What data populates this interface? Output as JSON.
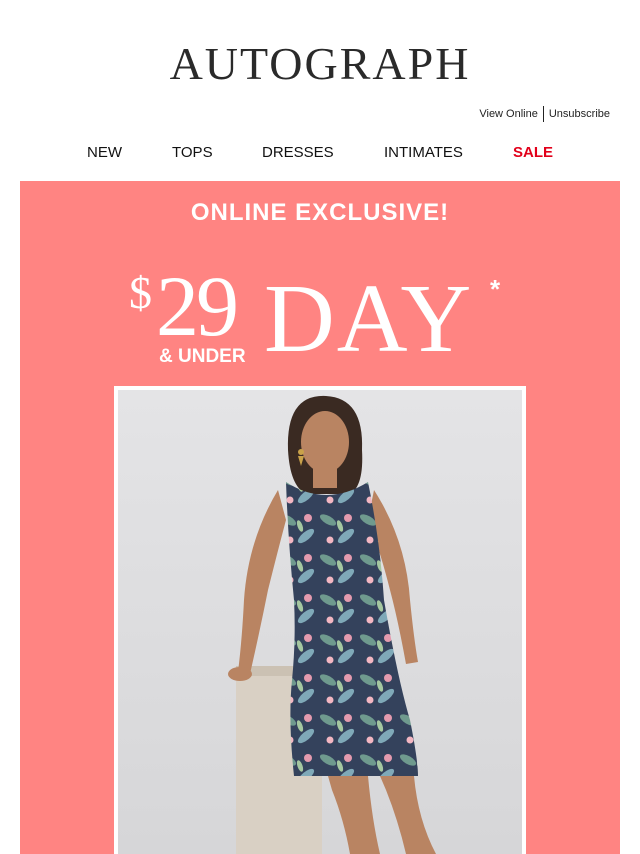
{
  "header": {
    "brand": "AUTOGRAPH",
    "view_online": "View Online",
    "unsubscribe": "Unsubscribe"
  },
  "nav": {
    "items": [
      "NEW",
      "TOPS",
      "DRESSES",
      "INTIMATES",
      "SALE"
    ]
  },
  "hero": {
    "kicker": "ONLINE EXCLUSIVE!",
    "currency": "$",
    "price": "29",
    "price_suffix": "& UNDER",
    "day": "DAY",
    "asterisk": "*"
  },
  "colors": {
    "hero_bg": "#ff8482",
    "sale": "#e2001a",
    "text": "#111111"
  },
  "icons": [
    "model-photo"
  ]
}
